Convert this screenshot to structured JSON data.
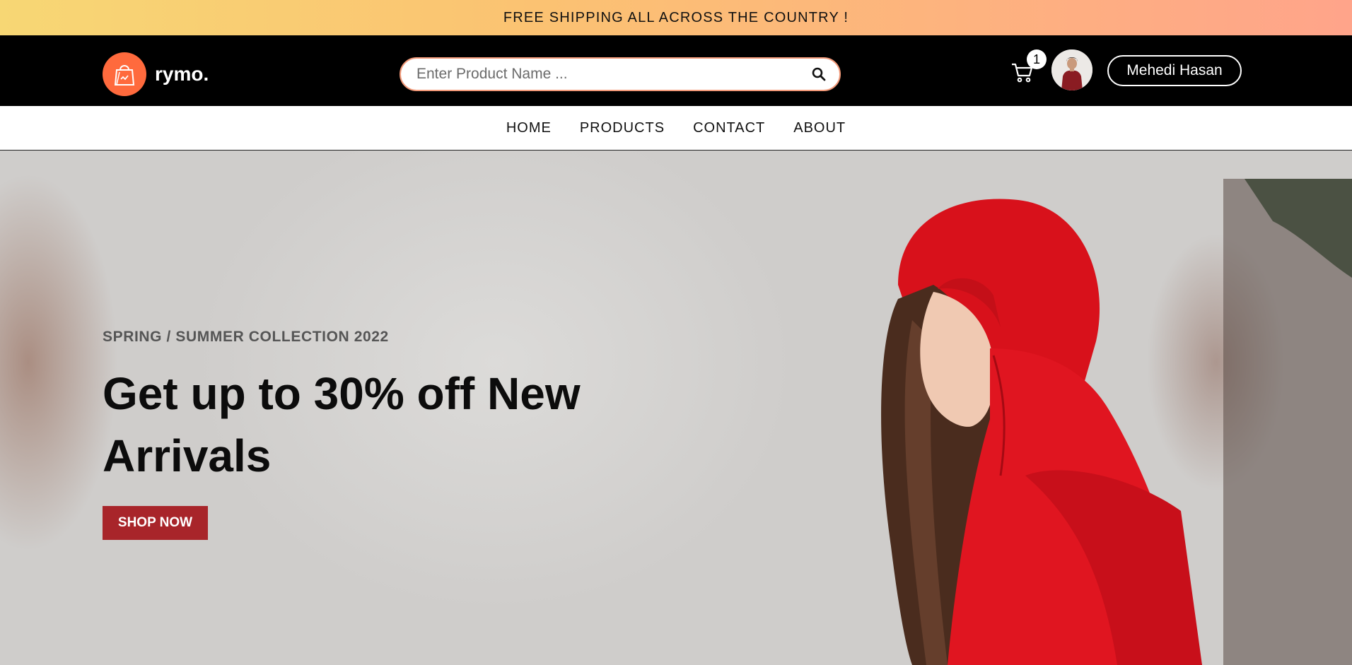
{
  "announcement": "FREE SHIPPING ALL ACROSS THE COUNTRY !",
  "brand": {
    "name": "rymo.",
    "accent": "#ff6a3d"
  },
  "search": {
    "placeholder": "Enter Product Name ..."
  },
  "cart": {
    "count": "1"
  },
  "user": {
    "name": "Mehedi Hasan"
  },
  "nav": {
    "items": [
      "HOME",
      "PRODUCTS",
      "CONTACT",
      "ABOUT"
    ]
  },
  "hero": {
    "subtitle": "SPRING / SUMMER COLLECTION 2022",
    "title": "Get up to 30% off New Arrivals",
    "cta": "SHOP NOW",
    "cta_color": "#a8252a"
  },
  "icons": [
    "shopping-bag-icon",
    "search-icon",
    "cart-icon"
  ]
}
